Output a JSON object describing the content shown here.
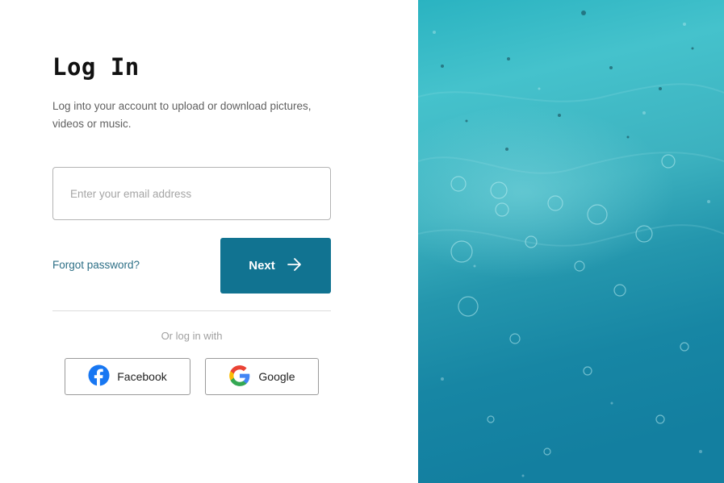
{
  "login": {
    "title": "Log In",
    "subtitle": "Log into your account to upload or download pictures, videos or music.",
    "email": {
      "placeholder": "Enter your email address",
      "value": ""
    },
    "forgot_label": "Forgot password?",
    "next_label": "Next",
    "or_label": "Or log in with",
    "social": [
      {
        "label": "Facebook",
        "icon": "facebook-icon"
      },
      {
        "label": "Google",
        "icon": "google-icon"
      }
    ]
  },
  "theme": {
    "accent": "#117391",
    "link": "#2d6f86",
    "facebook_blue": "#1877f2"
  },
  "hero": {
    "subject": "water-surface-photo"
  }
}
